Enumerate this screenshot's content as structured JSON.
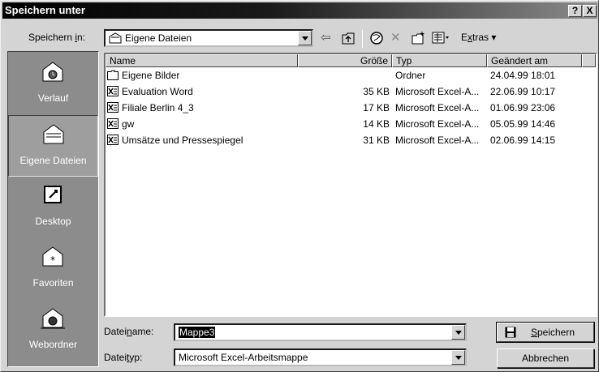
{
  "dialog": {
    "title": "Speichern unter",
    "help_label": "?",
    "close_label": "X"
  },
  "save_in": {
    "label_pre": "Speichern ",
    "label_key": "i",
    "label_post": "n:",
    "value": "Eigene Dateien"
  },
  "toolbar": {
    "extras_pre": "E",
    "extras_key": "x",
    "extras_post": "tras ▾"
  },
  "places": [
    {
      "label": "Verlauf",
      "icon": "history-icon"
    },
    {
      "label": "Eigene Dateien",
      "icon": "my-documents-icon"
    },
    {
      "label": "Desktop",
      "icon": "desktop-icon"
    },
    {
      "label": "Favoriten",
      "icon": "favorites-icon"
    },
    {
      "label": "Webordner",
      "icon": "web-folders-icon"
    }
  ],
  "columns": {
    "name": "Name",
    "size": "Größe",
    "type": "Typ",
    "modified": "Geändert am"
  },
  "files": [
    {
      "name": "Eigene Bilder",
      "size": "",
      "type": "Ordner",
      "modified": "24.04.99 18:01",
      "icon": "folder-icon"
    },
    {
      "name": "Evaluation Word",
      "size": "35 KB",
      "type": "Microsoft Excel-A...",
      "modified": "22.06.99 10:17",
      "icon": "excel-file-icon"
    },
    {
      "name": "Filiale Berlin 4_3",
      "size": "17 KB",
      "type": "Microsoft Excel-A...",
      "modified": "01.06.99 23:06",
      "icon": "excel-file-icon"
    },
    {
      "name": "gw",
      "size": "14 KB",
      "type": "Microsoft Excel-A...",
      "modified": "05.05.99 14:46",
      "icon": "excel-file-icon"
    },
    {
      "name": "Umsätze und Pressespiegel",
      "size": "31 KB",
      "type": "Microsoft Excel-A...",
      "modified": "02.06.99 14:15",
      "icon": "excel-file-icon"
    }
  ],
  "filename": {
    "label_pre": "Datei",
    "label_key": "n",
    "label_post": "ame:",
    "value": "Mappe3"
  },
  "filetype": {
    "label_pre": "Datei",
    "label_key": "t",
    "label_post": "yp:",
    "value": "Microsoft Excel-Arbeitsmappe"
  },
  "buttons": {
    "save_key": "S",
    "save_rest": "peichern",
    "cancel": "Abbrechen"
  }
}
